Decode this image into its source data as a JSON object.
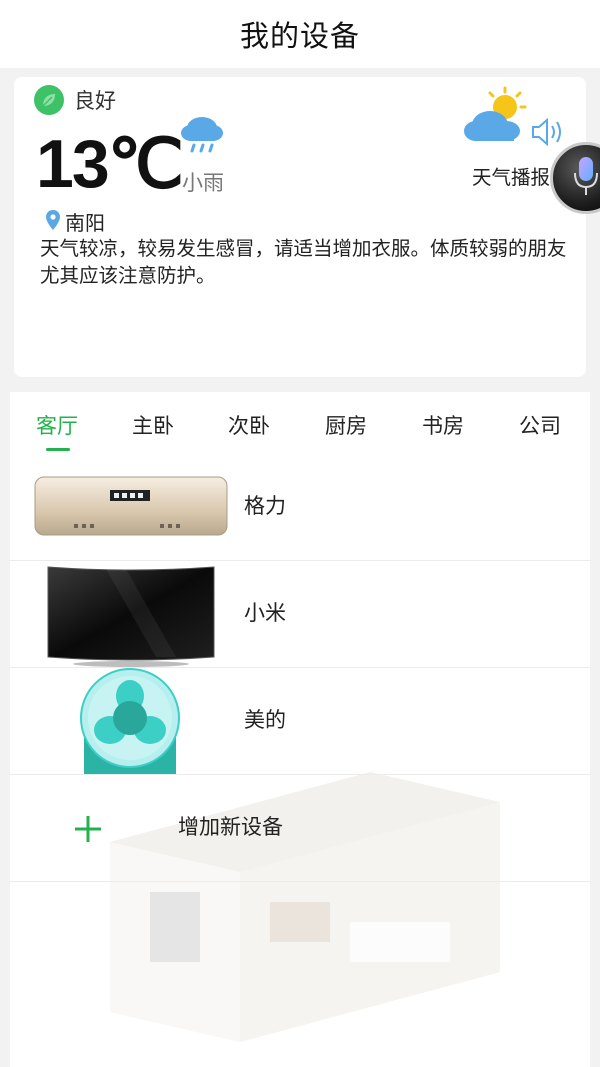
{
  "header": {
    "title": "我的设备"
  },
  "weather": {
    "air_quality": "良好",
    "temperature": "13℃",
    "condition": "小雨",
    "location": "南阳",
    "advice": "天气较凉，较易发生感冒，请适当增加衣服。体质较弱的朋友尤其应该注意防护。",
    "broadcast_label": "天气播报"
  },
  "tabs": [
    {
      "label": "客厅",
      "active": true
    },
    {
      "label": "主卧"
    },
    {
      "label": "次卧"
    },
    {
      "label": "厨房"
    },
    {
      "label": "书房"
    },
    {
      "label": "公司"
    }
  ],
  "devices": [
    {
      "name": "格力",
      "icon": "air-conditioner-icon"
    },
    {
      "name": "小米",
      "icon": "tv-icon"
    },
    {
      "name": "美的",
      "icon": "fan-icon"
    }
  ],
  "add_device": {
    "label": "增加新设备"
  },
  "colors": {
    "accent": "#22b14c",
    "leaf": "#3ec267",
    "rain": "#5aa8e6"
  }
}
